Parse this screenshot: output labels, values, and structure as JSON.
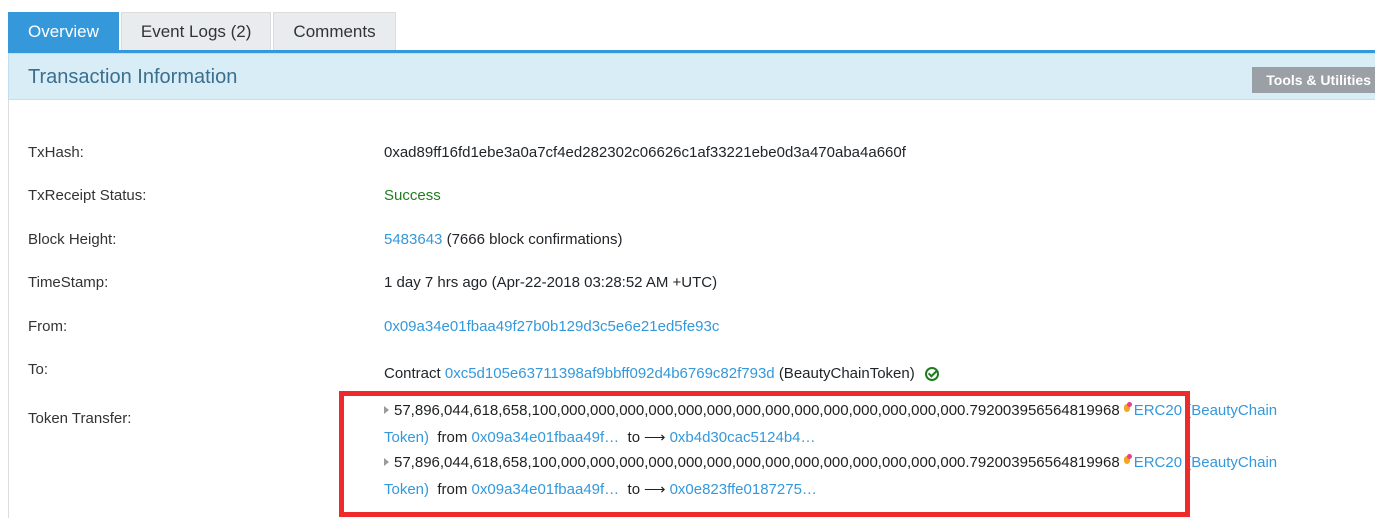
{
  "tabs": [
    {
      "label": "Overview"
    },
    {
      "label": "Event Logs (2)"
    },
    {
      "label": "Comments"
    }
  ],
  "header": {
    "title": "Transaction Information",
    "tools_label": "Tools & Utilities"
  },
  "details": {
    "txhash": {
      "label": "TxHash:",
      "value": "0xad89ff16fd1ebe3a0a7cf4ed282302c06626c1af33221ebe0d3a470aba4a660f"
    },
    "status": {
      "label": "TxReceipt Status:",
      "value": "Success"
    },
    "block": {
      "label": "Block Height:",
      "number": "5483643",
      "confirmations": "(7666 block confirmations)"
    },
    "timestamp": {
      "label": "TimeStamp:",
      "value": "1 day 7 hrs ago (Apr-22-2018 03:28:52 AM +UTC)"
    },
    "from": {
      "label": "From:",
      "value": "0x09a34e01fbaa49f27b0b129d3c5e6e21ed5fe93c"
    },
    "to": {
      "label": "To:",
      "prefix": "Contract",
      "address": "0xc5d105e63711398af9bbff092d4b6769c82f793d",
      "name": "(BeautyChainToken)"
    }
  },
  "token_transfer": {
    "label": "Token Transfer:",
    "transfers": [
      {
        "amount": "57,896,044,618,658,100,000,000,000,000,000,000,000,000,000,000,000,000,000,000.792003956564819968",
        "token_part1": "ERC20 (BeautyChain",
        "token_part2": "Token)",
        "from_label": "from",
        "from": "0x09a34e01fbaa49f…",
        "to_label": "to",
        "to": "0xb4d30cac5124b4…"
      },
      {
        "amount": "57,896,044,618,658,100,000,000,000,000,000,000,000,000,000,000,000,000,000,000.792003956564819968",
        "token_part1": "ERC20 (BeautyChain",
        "token_part2": "Token)",
        "from_label": "from",
        "from": "0x09a34e01fbaa49f…",
        "to_label": "to",
        "to": "0x0e823ffe0187275…"
      }
    ]
  },
  "colors": {
    "accent": "#3498db",
    "success": "#1e7e1e",
    "highlight": "#ee2a2a"
  },
  "icons": [
    "check-circle-icon",
    "caret-right-icon",
    "token-icon",
    "arrow-right-icon"
  ]
}
